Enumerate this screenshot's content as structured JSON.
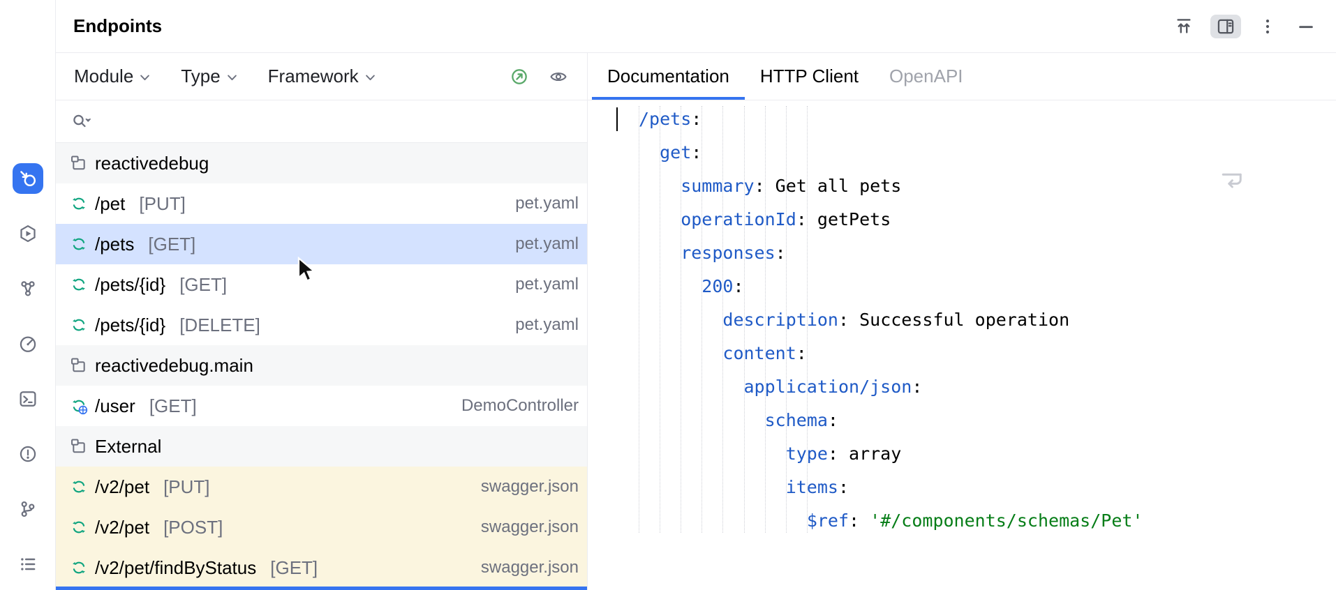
{
  "window": {
    "title": "Endpoints"
  },
  "header": {
    "actions": [
      {
        "name": "scroll-to-top",
        "icon": "scroll-top",
        "active": false
      },
      {
        "name": "details-view-toggle",
        "icon": "panel-toggle",
        "active": true
      },
      {
        "name": "more-options",
        "icon": "kebab",
        "active": false
      },
      {
        "name": "hide-tool-window",
        "icon": "minimize",
        "active": false
      }
    ]
  },
  "stripe": {
    "items": [
      {
        "name": "endpoints",
        "icon": "endpoints",
        "selected": true
      },
      {
        "name": "services",
        "icon": "services",
        "selected": false
      },
      {
        "name": "dependencies",
        "icon": "dependencies",
        "selected": false
      },
      {
        "name": "profiler",
        "icon": "profiler",
        "selected": false
      },
      {
        "name": "terminal",
        "icon": "terminal",
        "selected": false
      },
      {
        "name": "problems",
        "icon": "problems",
        "selected": false
      },
      {
        "name": "version-control",
        "icon": "git",
        "selected": false
      },
      {
        "name": "more-tool-windows",
        "icon": "more-tools",
        "selected": false
      }
    ]
  },
  "filters": {
    "items": [
      {
        "label": "Module"
      },
      {
        "label": "Type"
      },
      {
        "label": "Framework"
      }
    ],
    "actions": [
      {
        "name": "api-status",
        "icon": "api-ok"
      },
      {
        "name": "view-options",
        "icon": "eye"
      }
    ]
  },
  "search": {
    "placeholder": "",
    "icon": "search-with-history"
  },
  "list": {
    "rows": [
      {
        "kind": "module",
        "label": "reactivedebug",
        "icon": "module"
      },
      {
        "kind": "endpoint",
        "path": "/pet",
        "method": "[PUT]",
        "detail": "pet.yaml",
        "icon": "endpoint"
      },
      {
        "kind": "endpoint",
        "path": "/pets",
        "method": "[GET]",
        "detail": "pet.yaml",
        "icon": "endpoint",
        "selected": true
      },
      {
        "kind": "endpoint",
        "path": "/pets/{id}",
        "method": "[GET]",
        "detail": "pet.yaml",
        "icon": "endpoint"
      },
      {
        "kind": "endpoint",
        "path": "/pets/{id}",
        "method": "[DELETE]",
        "detail": "pet.yaml",
        "icon": "endpoint"
      },
      {
        "kind": "module",
        "label": "reactivedebug.main",
        "icon": "module"
      },
      {
        "kind": "endpoint",
        "path": "/user",
        "method": "[GET]",
        "detail": "DemoController",
        "icon": "endpoint-globe"
      },
      {
        "kind": "module",
        "label": "External",
        "icon": "module"
      },
      {
        "kind": "endpoint",
        "path": "/v2/pet",
        "method": "[PUT]",
        "detail": "swagger.json",
        "icon": "endpoint",
        "external": true
      },
      {
        "kind": "endpoint",
        "path": "/v2/pet",
        "method": "[POST]",
        "detail": "swagger.json",
        "icon": "endpoint",
        "external": true
      },
      {
        "kind": "endpoint",
        "path": "/v2/pet/findByStatus",
        "method": "[GET]",
        "detail": "swagger.json",
        "icon": "endpoint",
        "external": true
      }
    ]
  },
  "tabs": [
    {
      "label": "Documentation",
      "selected": true,
      "dimmed": false
    },
    {
      "label": "HTTP Client",
      "selected": false,
      "dimmed": false
    },
    {
      "label": "OpenAPI",
      "selected": false,
      "dimmed": true
    }
  ],
  "code": {
    "language": "yaml",
    "guide_columns": 9,
    "lines": [
      {
        "indent": 0,
        "tokens": [
          {
            "type": "key",
            "text": "/pets"
          },
          {
            "type": "punct",
            "text": ":"
          }
        ]
      },
      {
        "indent": 2,
        "tokens": [
          {
            "type": "key",
            "text": "get"
          },
          {
            "type": "punct",
            "text": ":"
          }
        ]
      },
      {
        "indent": 4,
        "tokens": [
          {
            "type": "key",
            "text": "summary"
          },
          {
            "type": "punct",
            "text": ": "
          },
          {
            "type": "plain",
            "text": "Get all pets"
          }
        ]
      },
      {
        "indent": 4,
        "tokens": [
          {
            "type": "key",
            "text": "operationId"
          },
          {
            "type": "punct",
            "text": ": "
          },
          {
            "type": "plain",
            "text": "getPets"
          }
        ]
      },
      {
        "indent": 4,
        "tokens": [
          {
            "type": "key",
            "text": "responses"
          },
          {
            "type": "punct",
            "text": ":"
          }
        ]
      },
      {
        "indent": 6,
        "tokens": [
          {
            "type": "key",
            "text": "200"
          },
          {
            "type": "punct",
            "text": ":"
          }
        ]
      },
      {
        "indent": 8,
        "tokens": [
          {
            "type": "key",
            "text": "description"
          },
          {
            "type": "punct",
            "text": ": "
          },
          {
            "type": "plain",
            "text": "Successful operation"
          }
        ]
      },
      {
        "indent": 8,
        "tokens": [
          {
            "type": "key",
            "text": "content"
          },
          {
            "type": "punct",
            "text": ":"
          }
        ]
      },
      {
        "indent": 10,
        "tokens": [
          {
            "type": "key",
            "text": "application/json"
          },
          {
            "type": "punct",
            "text": ":"
          }
        ]
      },
      {
        "indent": 12,
        "tokens": [
          {
            "type": "key",
            "text": "schema"
          },
          {
            "type": "punct",
            "text": ":"
          }
        ]
      },
      {
        "indent": 14,
        "tokens": [
          {
            "type": "key",
            "text": "type"
          },
          {
            "type": "punct",
            "text": ": "
          },
          {
            "type": "plain",
            "text": "array"
          }
        ]
      },
      {
        "indent": 14,
        "tokens": [
          {
            "type": "key",
            "text": "items"
          },
          {
            "type": "punct",
            "text": ":"
          }
        ]
      },
      {
        "indent": 16,
        "tokens": [
          {
            "type": "key",
            "text": "$ref"
          },
          {
            "type": "punct",
            "text": ": "
          },
          {
            "type": "str",
            "text": "'#/components/schemas/Pet'"
          }
        ]
      }
    ]
  },
  "colors": {
    "accent": "#3574F0",
    "selection": "#D4E2FF",
    "external_row": "#FBF5DF",
    "module_row": "#F6F7F8",
    "border": "#EBECF0",
    "icon_gray": "#6C707E",
    "text": "#000000",
    "text_secondary": "#6C707E",
    "yaml_key": "#1F5AC6",
    "yaml_string": "#067D17",
    "endpoint_green": "#0EA47F",
    "ok_green": "#59A869",
    "tab_dimmed": "#A0A3AB",
    "toggle_bg": "#DFE1E5"
  }
}
